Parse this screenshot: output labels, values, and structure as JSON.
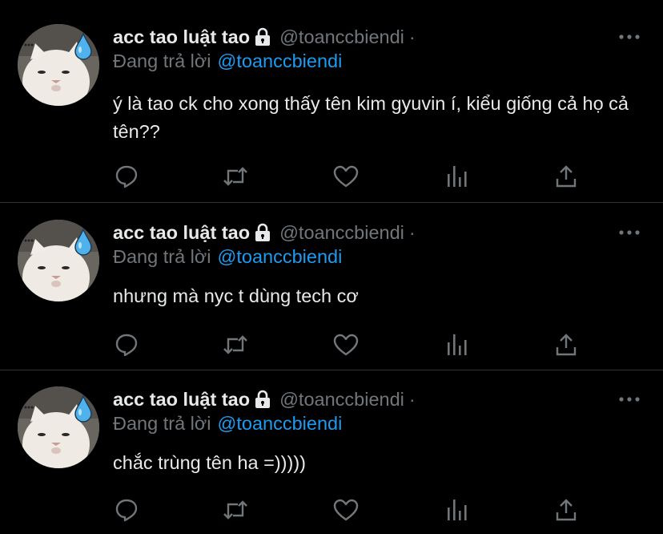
{
  "colors": {
    "background": "#000000",
    "primary_text": "#e7e9ea",
    "secondary_text": "#71767b",
    "link": "#1d9bf0",
    "divider": "#2f3336",
    "icon": "#71767b"
  },
  "tweets": [
    {
      "display_name": "acc tao luật tao",
      "handle": "@toanccbiendi",
      "separator": "·",
      "reply_prefix": "Đang trả lời",
      "reply_to": "@toanccbiendi",
      "text": "ý là tao ck cho xong thấy tên kim gyuvin í, kiểu giống cả họ cả tên??",
      "icons": [
        "lock-icon",
        "more-icon",
        "reply-icon",
        "retweet-icon",
        "like-icon",
        "analytics-icon",
        "share-icon"
      ]
    },
    {
      "display_name": "acc tao luật tao",
      "handle": "@toanccbiendi",
      "separator": "·",
      "reply_prefix": "Đang trả lời",
      "reply_to": "@toanccbiendi",
      "text": "nhưng mà nyc t dùng tech cơ",
      "icons": [
        "lock-icon",
        "more-icon",
        "reply-icon",
        "retweet-icon",
        "like-icon",
        "analytics-icon",
        "share-icon"
      ]
    },
    {
      "display_name": "acc tao luật tao",
      "handle": "@toanccbiendi",
      "separator": "·",
      "reply_prefix": "Đang trả lời",
      "reply_to": "@toanccbiendi",
      "text": "chắc trùng tên ha =)))))",
      "icons": [
        "lock-icon",
        "more-icon",
        "reply-icon",
        "retweet-icon",
        "like-icon",
        "analytics-icon",
        "share-icon"
      ]
    }
  ]
}
